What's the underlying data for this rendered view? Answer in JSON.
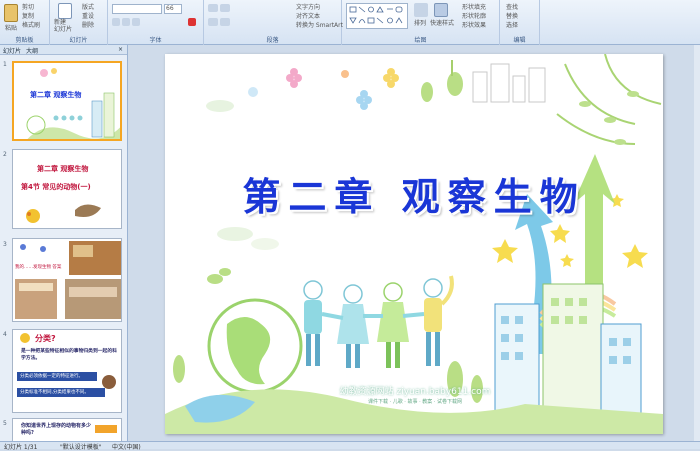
{
  "ribbon": {
    "paste_label": "粘贴",
    "cut": "剪切",
    "copy": "复制",
    "format_painter": "格式刷",
    "new_slide_label": "新建\n幻灯片",
    "layout": "版式",
    "reset": "重设",
    "delete": "删除",
    "font_size": "66",
    "text_direction": "文字方向",
    "align_text": "对齐文本",
    "smartart": "转换为 SmartArt",
    "arrange": "排列",
    "quick_styles": "快速样式",
    "shape_fill": "形状填充",
    "shape_outline": "形状轮廓",
    "shape_effects": "形状效果",
    "find": "查找",
    "replace": "替换",
    "select": "选择",
    "groups": {
      "clipboard": "剪贴板",
      "slides": "幻灯片",
      "font": "字体",
      "paragraph": "段落",
      "drawing": "绘图",
      "editing": "编辑"
    }
  },
  "panel": {
    "tab_slides": "幻灯片",
    "tab_outline": "大纲",
    "close": "×"
  },
  "thumbs": [
    {
      "num": "1",
      "title": "第二章  观察生物"
    },
    {
      "num": "2",
      "heading": "第二章  观察生物",
      "sub": "第4节  常见的动物(一)"
    },
    {
      "num": "3",
      "caption": "我的……发现生物 答案"
    },
    {
      "num": "4",
      "heading": "分类?",
      "text": "是一种把某些特征相似的事物归类到一起的科学方法。",
      "b1": "分类必须依据一定的特征进行。",
      "b2": "分类标准不相同,分类结果也不同。"
    },
    {
      "num": "5",
      "text": "你知道世界上现存的动物有多少种吗?"
    }
  ],
  "slide": {
    "title": "第二章  观察生物",
    "watermark": "幼教资源网站  ziyuan.baby611.com",
    "watermark_sub": "课件下载 · 儿歌 · 故事 · 教案 · 试卷下载网"
  },
  "status": {
    "slide_pos": "幻灯片 1/31",
    "theme": "\"默认设计模板\"",
    "lang": "中文(中国)"
  }
}
